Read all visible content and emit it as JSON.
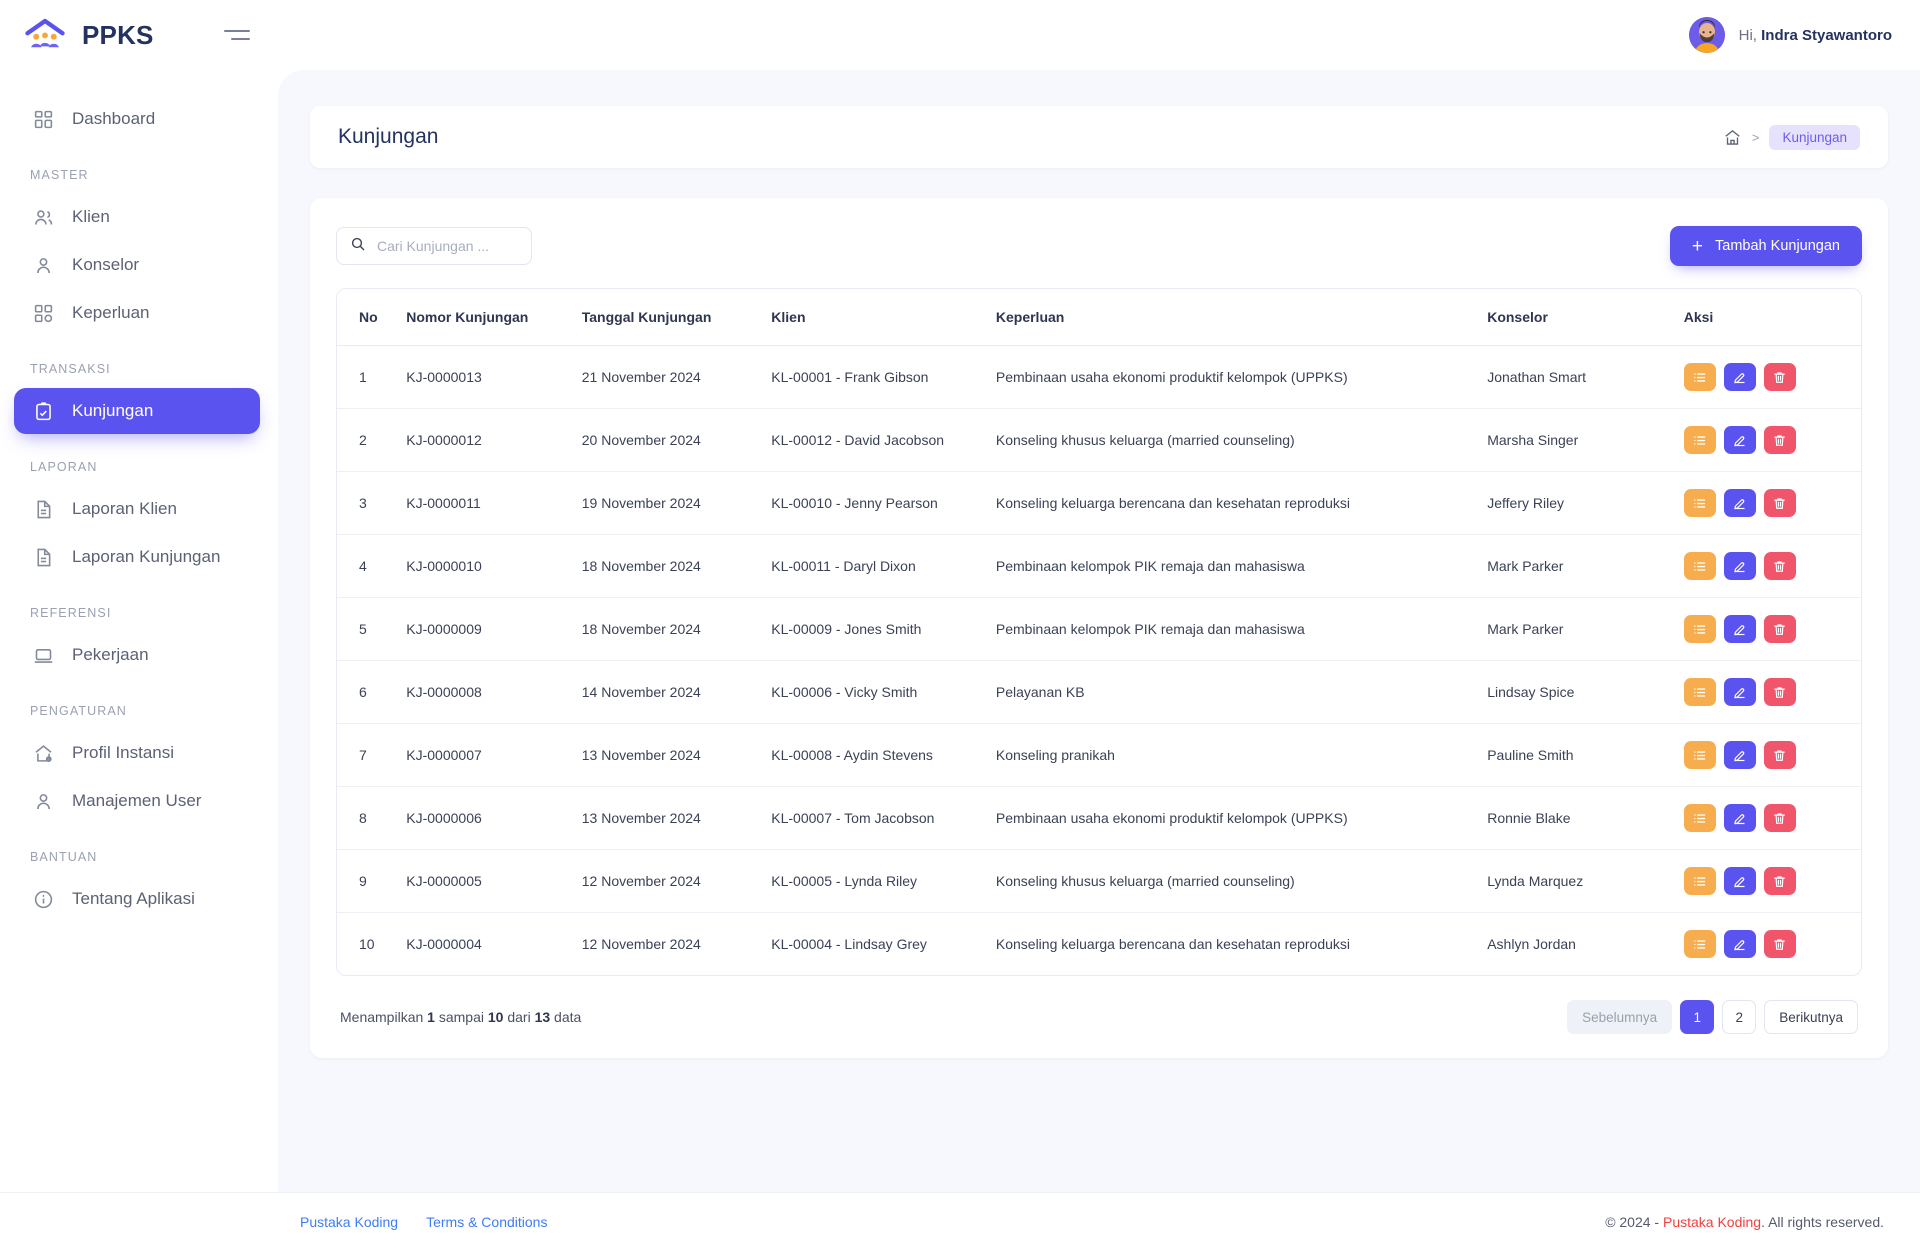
{
  "app": {
    "brand": "PPKS",
    "colors": {
      "primary": "#5b53f0",
      "orange": "#f7ad4e",
      "red": "#f0556b",
      "link": "#3f7cf6",
      "title": "#24325f"
    }
  },
  "header": {
    "greeting_prefix": "Hi,",
    "user_name": "Indra Styawantoro",
    "menu_toggle": "hamburger-icon"
  },
  "sidebar": {
    "groups": [
      {
        "label": null,
        "items": [
          {
            "label": "Dashboard",
            "icon": "dashboard-icon",
            "active": false
          }
        ]
      },
      {
        "label": "MASTER",
        "items": [
          {
            "label": "Klien",
            "icon": "users-icon",
            "active": false
          },
          {
            "label": "Konselor",
            "icon": "user-icon",
            "active": false
          },
          {
            "label": "Keperluan",
            "icon": "grid-icon",
            "active": false
          }
        ]
      },
      {
        "label": "TRANSAKSI",
        "items": [
          {
            "label": "Kunjungan",
            "icon": "clipboard-check-icon",
            "active": true
          }
        ]
      },
      {
        "label": "LAPORAN",
        "items": [
          {
            "label": "Laporan Klien",
            "icon": "file-icon",
            "active": false
          },
          {
            "label": "Laporan Kunjungan",
            "icon": "file-icon",
            "active": false
          }
        ]
      },
      {
        "label": "REFERENSI",
        "items": [
          {
            "label": "Pekerjaan",
            "icon": "laptop-icon",
            "active": false
          }
        ]
      },
      {
        "label": "PENGATURAN",
        "items": [
          {
            "label": "Profil Instansi",
            "icon": "home-gear-icon",
            "active": false
          },
          {
            "label": "Manajemen User",
            "icon": "user-icon",
            "active": false
          }
        ]
      },
      {
        "label": "BANTUAN",
        "items": [
          {
            "label": "Tentang Aplikasi",
            "icon": "info-icon",
            "active": false
          }
        ]
      }
    ]
  },
  "page": {
    "title": "Kunjungan",
    "breadcrumb": {
      "home_icon": "home-icon",
      "separator": ">",
      "current": "Kunjungan"
    }
  },
  "toolbar": {
    "search_placeholder": "Cari Kunjungan ...",
    "search_value": "",
    "add_label": "Tambah Kunjungan",
    "add_plus": "+"
  },
  "table": {
    "columns": [
      "No",
      "Nomor Kunjungan",
      "Tanggal Kunjungan",
      "Klien",
      "Keperluan",
      "Konselor",
      "Aksi"
    ],
    "rows": [
      {
        "no": "1",
        "nomor": "KJ-0000013",
        "tanggal": "21 November 2024",
        "klien": "KL-00001 - Frank Gibson",
        "keperluan": "Pembinaan usaha ekonomi produktif kelompok (UPPKS)",
        "konselor": "Jonathan Smart"
      },
      {
        "no": "2",
        "nomor": "KJ-0000012",
        "tanggal": "20 November 2024",
        "klien": "KL-00012 - David Jacobson",
        "keperluan": "Konseling khusus keluarga (married counseling)",
        "konselor": "Marsha Singer"
      },
      {
        "no": "3",
        "nomor": "KJ-0000011",
        "tanggal": "19 November 2024",
        "klien": "KL-00010 - Jenny Pearson",
        "keperluan": "Konseling keluarga berencana dan kesehatan reproduksi",
        "konselor": "Jeffery Riley"
      },
      {
        "no": "4",
        "nomor": "KJ-0000010",
        "tanggal": "18 November 2024",
        "klien": "KL-00011 - Daryl Dixon",
        "keperluan": "Pembinaan kelompok PIK remaja dan mahasiswa",
        "konselor": "Mark Parker"
      },
      {
        "no": "5",
        "nomor": "KJ-0000009",
        "tanggal": "18 November 2024",
        "klien": "KL-00009 - Jones Smith",
        "keperluan": "Pembinaan kelompok PIK remaja dan mahasiswa",
        "konselor": "Mark Parker"
      },
      {
        "no": "6",
        "nomor": "KJ-0000008",
        "tanggal": "14 November 2024",
        "klien": "KL-00006 - Vicky Smith",
        "keperluan": "Pelayanan KB",
        "konselor": "Lindsay Spice"
      },
      {
        "no": "7",
        "nomor": "KJ-0000007",
        "tanggal": "13 November 2024",
        "klien": "KL-00008 - Aydin Stevens",
        "keperluan": "Konseling pranikah",
        "konselor": "Pauline Smith"
      },
      {
        "no": "8",
        "nomor": "KJ-0000006",
        "tanggal": "13 November 2024",
        "klien": "KL-00007 - Tom Jacobson",
        "keperluan": "Pembinaan usaha ekonomi produktif kelompok (UPPKS)",
        "konselor": "Ronnie Blake"
      },
      {
        "no": "9",
        "nomor": "KJ-0000005",
        "tanggal": "12 November 2024",
        "klien": "KL-00005 - Lynda Riley",
        "keperluan": "Konseling khusus keluarga (married counseling)",
        "konselor": "Lynda Marquez"
      },
      {
        "no": "10",
        "nomor": "KJ-0000004",
        "tanggal": "12 November 2024",
        "klien": "KL-00004 - Lindsay Grey",
        "keperluan": "Konseling keluarga berencana dan kesehatan reproduksi",
        "konselor": "Ashlyn Jordan"
      }
    ],
    "action_icons": [
      "list-detail-icon",
      "edit-pencil-icon",
      "trash-delete-icon"
    ]
  },
  "pagination": {
    "showing_parts": [
      "Menampilkan ",
      "1",
      " sampai ",
      "10",
      " dari ",
      "13",
      " data"
    ],
    "prev_label": "Sebelumnya",
    "next_label": "Berikutnya",
    "pages": [
      "1",
      "2"
    ],
    "active_page": "1"
  },
  "footer": {
    "links": [
      "Pustaka Koding",
      "Terms & Conditions"
    ],
    "copyright_prefix": "© 2024 - ",
    "copyright_brand": "Pustaka Koding",
    "copyright_suffix": ". All rights reserved."
  }
}
